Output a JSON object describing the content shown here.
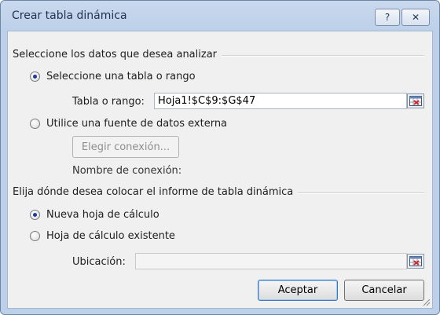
{
  "dialog": {
    "title": "Crear tabla dinámica",
    "help_label": "?",
    "close_label": "✕"
  },
  "source": {
    "group_title": "Seleccione los datos que desea analizar",
    "option_range": {
      "label": "Seleccione una tabla o rango",
      "checked": true
    },
    "range_label": "Tabla o rango:",
    "range_value": "Hoja1!$C$9:$G$47",
    "option_external": {
      "label": "Utilice una fuente de datos externa",
      "checked": false
    },
    "choose_connection_label": "Elegir conexión...",
    "connection_name_label": "Nombre de conexión:"
  },
  "destination": {
    "group_title": "Elija dónde desea colocar el informe de tabla dinámica",
    "option_new": {
      "label": "Nueva hoja de cálculo",
      "checked": true
    },
    "option_existing": {
      "label": "Hoja de cálculo existente",
      "checked": false
    },
    "location_label": "Ubicación:",
    "location_value": ""
  },
  "buttons": {
    "ok": "Aceptar",
    "cancel": "Cancelar"
  }
}
